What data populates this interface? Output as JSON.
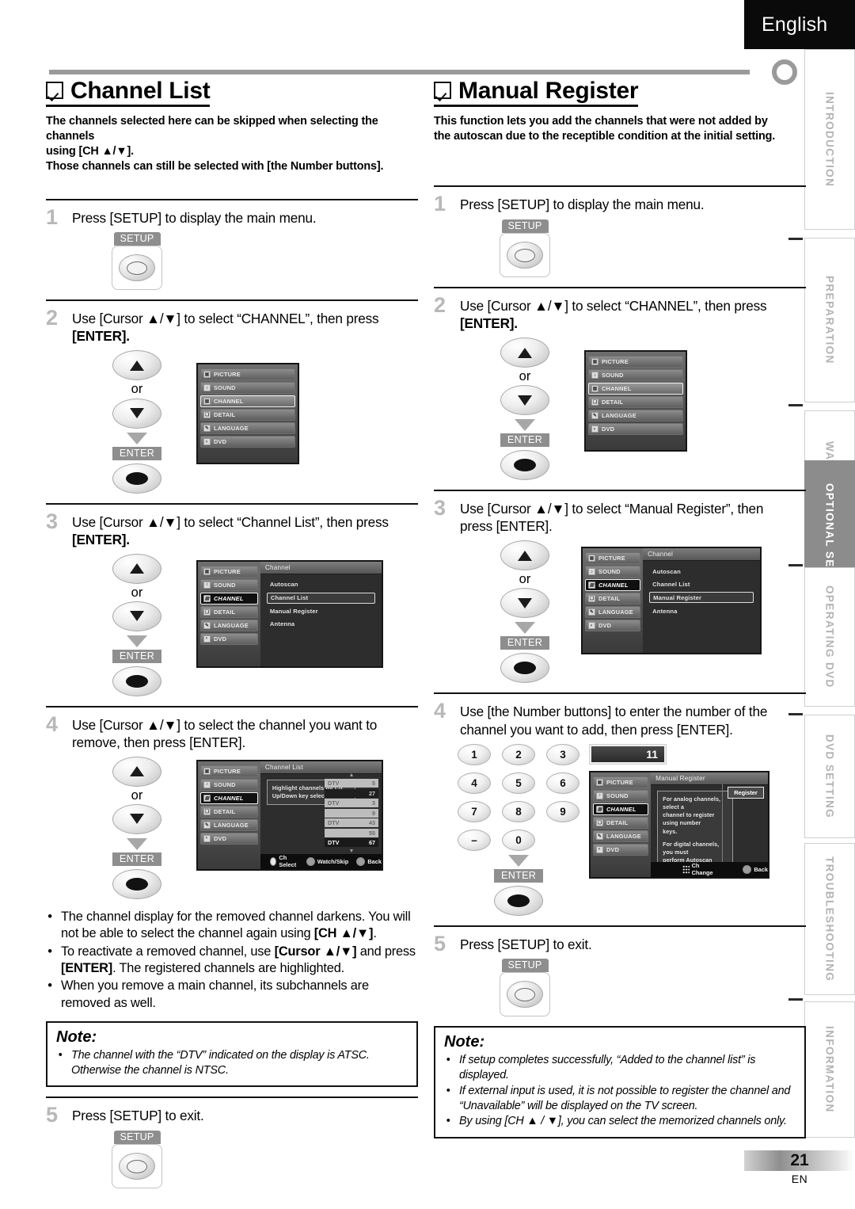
{
  "header": {
    "language": "English",
    "page_number": "21",
    "page_lang_code": "EN"
  },
  "sidebar": {
    "tabs": [
      {
        "label": "INTRODUCTION",
        "active": false
      },
      {
        "label": "PREPARATION",
        "active": false
      },
      {
        "label": "WATCHING TV",
        "active": false
      },
      {
        "label": "OPTIONAL SETTING",
        "active": true
      },
      {
        "label": "OPERATING DVD",
        "active": false
      },
      {
        "label": "DVD SETTING",
        "active": false
      },
      {
        "label": "TROUBLESHOOTING",
        "active": false
      },
      {
        "label": "INFORMATION",
        "active": false
      }
    ]
  },
  "left_section": {
    "title": "Channel List",
    "desc_line1": "The channels selected here can be skipped when selecting the channels",
    "desc_line2": "using [CH ▲/▼].",
    "desc_line3_pre": "Those channels can still be selected with [",
    "desc_line3_bold": "the Number buttons",
    "desc_line3_post": "].",
    "step1": {
      "num": "1",
      "text": "Press [SETUP] to display the main menu.",
      "key_cap": "SETUP"
    },
    "step2": {
      "num": "2",
      "line1": "Use [Cursor ▲/▼] to select “CHANNEL”, then press",
      "line2": "[ENTER].",
      "or": "or",
      "enter_cap": "ENTER"
    },
    "step3": {
      "num": "3",
      "line1": "Use [Cursor ▲/▼] to select “Channel List”, then press",
      "line2": "[ENTER].",
      "or": "or",
      "enter_cap": "ENTER"
    },
    "step4": {
      "num": "4",
      "line1": "Use [Cursor ▲/▼] to select the channel you want to",
      "line2": "remove, then press [ENTER].",
      "or": "or",
      "enter_cap": "ENTER"
    },
    "bullets": [
      "The channel display for the removed channel darkens. You will not be able to select the channel again using [CH ▲/▼].",
      "To reactivate a removed channel, use [Cursor ▲/▼] and press [ENTER]. The registered channels are highlighted.",
      "When you remove a main channel, its subchannels are removed as well."
    ],
    "note": {
      "title": "Note:",
      "items": [
        "The channel with the “DTV” indicated on the display is ATSC. Otherwise the channel is NTSC."
      ]
    },
    "step5": {
      "num": "5",
      "text": "Press [SETUP] to exit.",
      "key_cap": "SETUP"
    }
  },
  "right_section": {
    "title": "Manual Register",
    "desc_line1": "This function lets you add the channels that were not added by",
    "desc_line2": "the autoscan due to the receptible condition at the initial setting.",
    "step1": {
      "num": "1",
      "text": "Press [SETUP] to display the main menu.",
      "key_cap": "SETUP"
    },
    "step2": {
      "num": "2",
      "line1": "Use [Cursor ▲/▼] to select “CHANNEL”, then press",
      "line2": "[ENTER].",
      "or": "or",
      "enter_cap": "ENTER"
    },
    "step3": {
      "num": "3",
      "line1": "Use [Cursor ▲/▼] to select “Manual Register”, then",
      "line2": "press [ENTER].",
      "or": "or",
      "enter_cap": "ENTER"
    },
    "step4": {
      "num": "4",
      "line1": "Use [the Number buttons] to enter the number of the",
      "line2": "channel you want to add, then press [ENTER].",
      "enter_cap": "ENTER",
      "number_keys": [
        "1",
        "2",
        "3",
        "4",
        "5",
        "6",
        "7",
        "8",
        "9",
        "–",
        "0"
      ],
      "channel_badge": "11"
    },
    "step5": {
      "num": "5",
      "text": "Press [SETUP] to exit.",
      "key_cap": "SETUP"
    },
    "note": {
      "title": "Note:",
      "items": [
        "If setup completes successfully, “Added to the channel list” is displayed.",
        "If external input is used, it is not possible to register the channel and “Unavailable” will be displayed on the TV screen.",
        "By using [CH ▲ / ▼], you can select the memorized channels only."
      ]
    }
  },
  "osd": {
    "menu_items": [
      {
        "label": "PICTURE",
        "icon": "picture-icon"
      },
      {
        "label": "SOUND",
        "icon": "note-icon"
      },
      {
        "label": "CHANNEL",
        "icon": "grid-icon"
      },
      {
        "label": "DETAIL",
        "icon": "layers-icon"
      },
      {
        "label": "LANGUAGE",
        "icon": "pen-icon"
      },
      {
        "label": "DVD",
        "icon": "disc-icon"
      }
    ],
    "channel_screen": {
      "title": "Channel",
      "rows": [
        "Autoscan",
        "Channel List",
        "Manual Register",
        "Antenna"
      ],
      "highlight_channel_list": "Channel List",
      "highlight_manual_register": "Manual Register"
    },
    "channel_list_screen": {
      "title": "Channel List",
      "hint_line1": "Highlight channels for Ch",
      "hint_line2": "Up/Down key selection.",
      "channels": [
        {
          "tag": "DTV",
          "num": "5",
          "style": "lite"
        },
        {
          "tag": "",
          "num": "27",
          "style": "dim"
        },
        {
          "tag": "DTV",
          "num": "3",
          "style": "lite"
        },
        {
          "tag": "",
          "num": "9",
          "style": "lite"
        },
        {
          "tag": "DTV",
          "num": "43",
          "style": "lite"
        },
        {
          "tag": "",
          "num": "55",
          "style": "lite"
        },
        {
          "tag": "DTV",
          "num": "67",
          "style": "strong"
        }
      ],
      "footer": [
        "Ch Select",
        "Watch/Skip",
        "Back"
      ]
    },
    "manual_register_screen": {
      "title": "Manual Register",
      "note_line1": "For analog channels, select a",
      "note_line2": "channel to register using number",
      "note_line3": "keys.",
      "note_line4": "For digital channels, you must",
      "note_line5": "perform Autoscan function.",
      "register_button": "Register",
      "footer": [
        "Ch Change",
        "Back"
      ]
    }
  }
}
